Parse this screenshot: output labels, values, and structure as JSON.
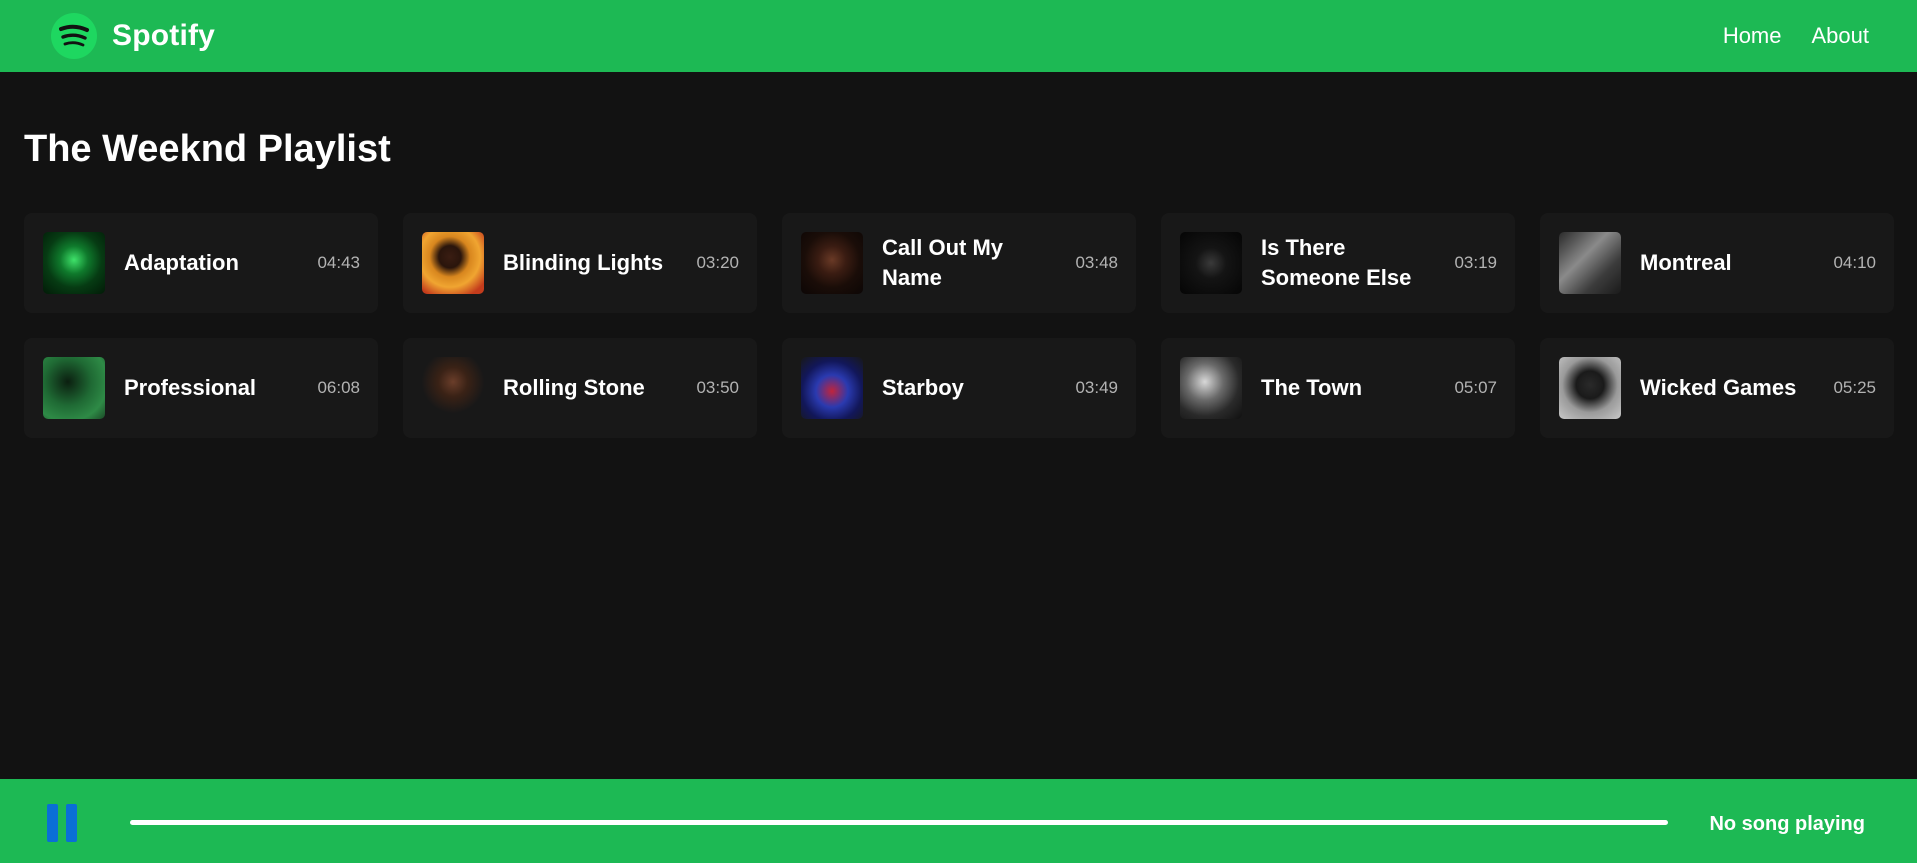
{
  "header": {
    "brand": "Spotify",
    "logo_icon": "spotify-logo-icon",
    "nav": [
      {
        "label": "Home"
      },
      {
        "label": "About"
      }
    ],
    "brand_color": "#1db954"
  },
  "main": {
    "title": "The Weeknd Playlist",
    "songs": [
      {
        "title": "Adaptation",
        "duration": "04:43",
        "cover_icon": "album-cover-image"
      },
      {
        "title": "Blinding Lights",
        "duration": "03:20",
        "cover_icon": "album-cover-image"
      },
      {
        "title": "Call Out My Name",
        "duration": "03:48",
        "cover_icon": "album-cover-image"
      },
      {
        "title": "Is There Someone Else",
        "duration": "03:19",
        "cover_icon": "album-cover-image"
      },
      {
        "title": "Montreal",
        "duration": "04:10",
        "cover_icon": "album-cover-image"
      },
      {
        "title": "Professional",
        "duration": "06:08",
        "cover_icon": "album-cover-image"
      },
      {
        "title": "Rolling Stone",
        "duration": "03:50",
        "cover_icon": "album-cover-image"
      },
      {
        "title": "Starboy",
        "duration": "03:49",
        "cover_icon": "album-cover-image"
      },
      {
        "title": "The Town",
        "duration": "05:07",
        "cover_icon": "album-cover-image"
      },
      {
        "title": "Wicked Games",
        "duration": "05:25",
        "cover_icon": "album-cover-image"
      }
    ]
  },
  "player": {
    "status": "No song playing",
    "play_state_icon": "pause-icon",
    "progress": 0
  }
}
